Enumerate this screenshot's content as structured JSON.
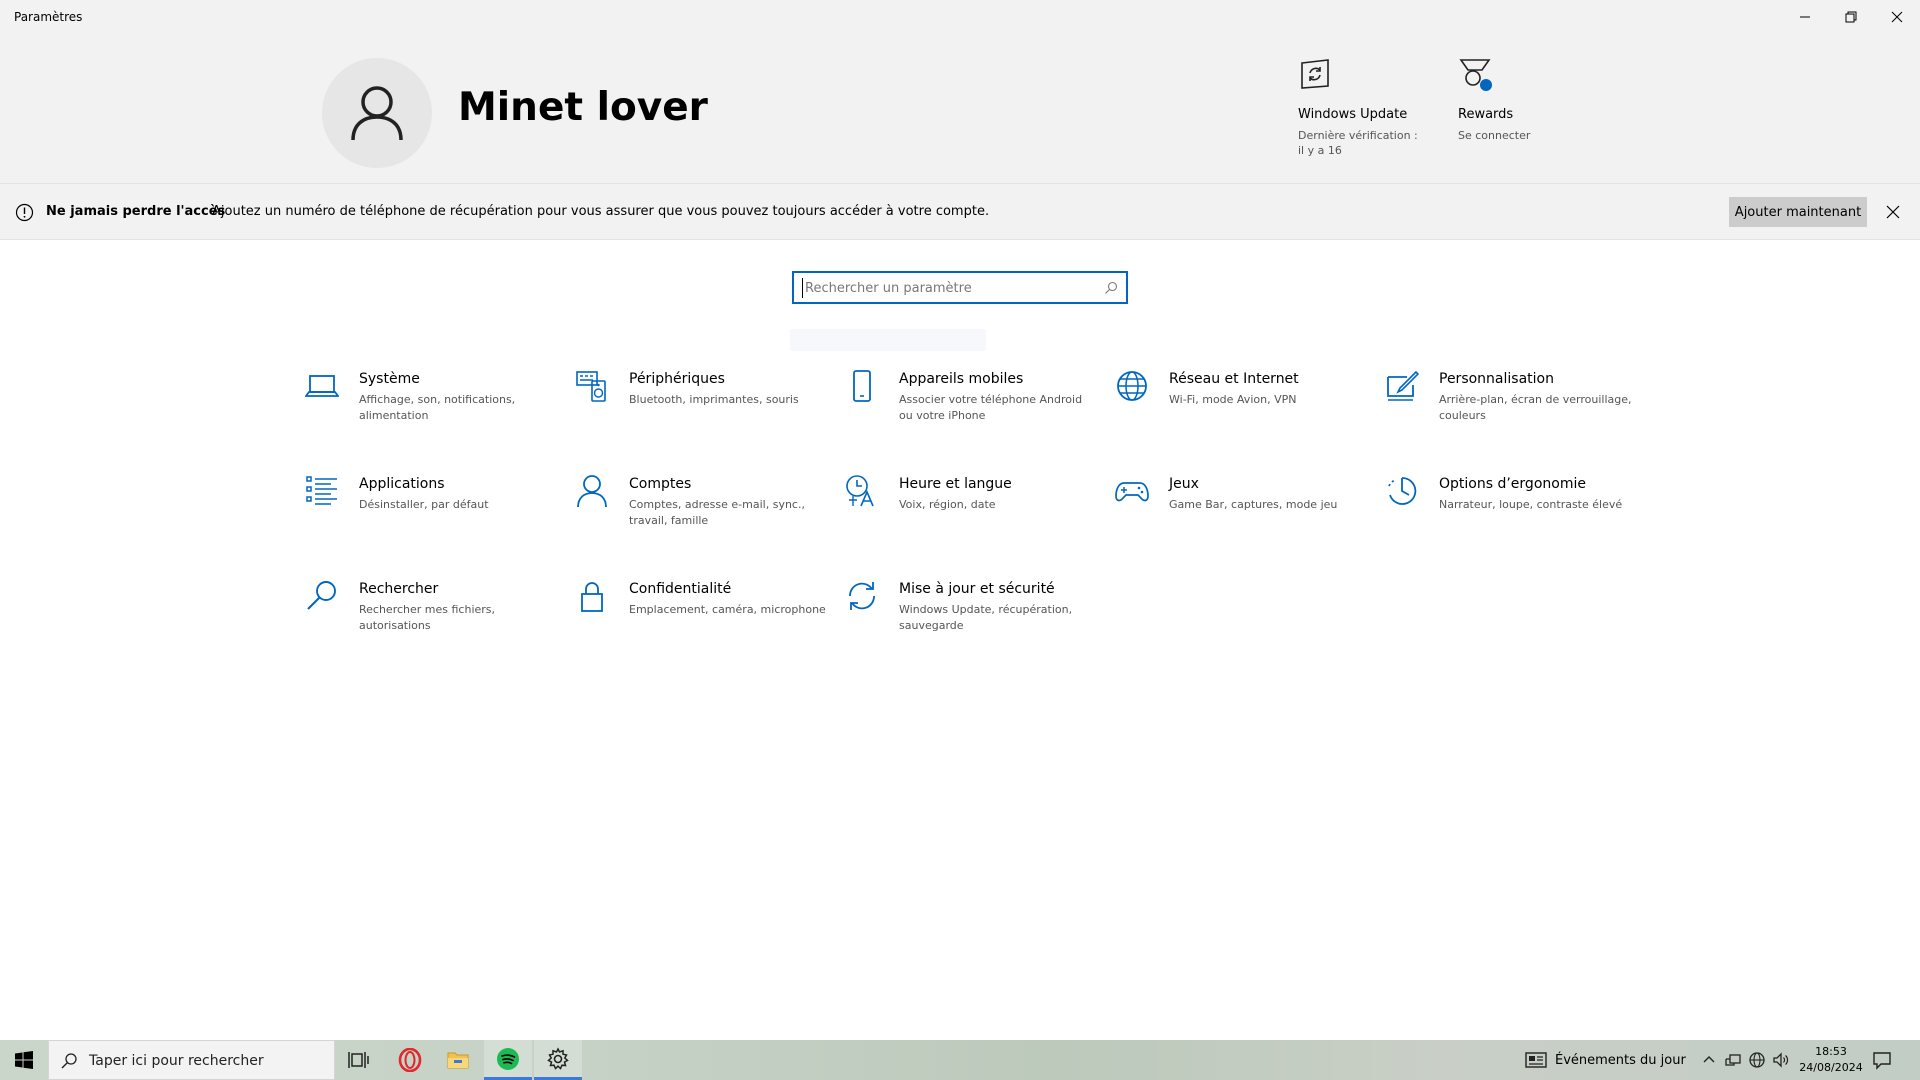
{
  "window": {
    "title": "Paramètres"
  },
  "profile": {
    "name": "Minet lover"
  },
  "header_tiles": {
    "windows_update": {
      "label": "Windows Update",
      "sub": "Dernière vérification : il y a 16"
    },
    "rewards": {
      "label": "Rewards",
      "sub": "Se connecter"
    }
  },
  "notification": {
    "title": "Ne jamais perdre l'accès",
    "message": "Ajoutez un numéro de téléphone de récupération pour vous assurer que vous pouvez toujours accéder à votre compte.",
    "button": "Ajouter maintenant"
  },
  "search": {
    "placeholder": "Rechercher un paramètre"
  },
  "categories": [
    {
      "title": "Système",
      "desc": "Affichage, son, notifications, alimentation",
      "icon": "laptop-icon"
    },
    {
      "title": "Périphériques",
      "desc": "Bluetooth, imprimantes, souris",
      "icon": "devices-icon"
    },
    {
      "title": "Appareils mobiles",
      "desc": "Associer votre téléphone Android ou votre iPhone",
      "icon": "phone-icon"
    },
    {
      "title": "Réseau et Internet",
      "desc": "Wi-Fi, mode Avion, VPN",
      "icon": "globe-icon"
    },
    {
      "title": "Personnalisation",
      "desc": "Arrière-plan, écran de verrouillage, couleurs",
      "icon": "personalization-icon"
    },
    {
      "title": "Applications",
      "desc": "Désinstaller, par défaut",
      "icon": "apps-list-icon"
    },
    {
      "title": "Comptes",
      "desc": "Comptes, adresse e-mail, sync., travail, famille",
      "icon": "person-icon"
    },
    {
      "title": "Heure et langue",
      "desc": "Voix, région, date",
      "icon": "time-language-icon"
    },
    {
      "title": "Jeux",
      "desc": "Game Bar, captures, mode jeu",
      "icon": "gamepad-icon"
    },
    {
      "title": "Options d’ergonomie",
      "desc": "Narrateur, loupe, contraste élevé",
      "icon": "accessibility-icon"
    },
    {
      "title": "Rechercher",
      "desc": "Rechercher mes fichiers, autorisations",
      "icon": "search-icon"
    },
    {
      "title": "Confidentialité",
      "desc": "Emplacement, caméra, microphone",
      "icon": "lock-icon"
    },
    {
      "title": "Mise à jour et sécurité",
      "desc": "Windows Update, récupération, sauvegarde",
      "icon": "update-icon"
    }
  ],
  "taskbar": {
    "search_placeholder": "Taper ici pour rechercher",
    "news": "Événements du jour",
    "time": "18:53",
    "date": "24/08/2024"
  },
  "colors": {
    "accent": "#0067c0",
    "icon_blue": "#0067c0",
    "header_bg": "#f2f2f2",
    "spotify_green": "#1db954",
    "opera_red": "#e0282e",
    "folder_yellow": "#f2c14e"
  }
}
